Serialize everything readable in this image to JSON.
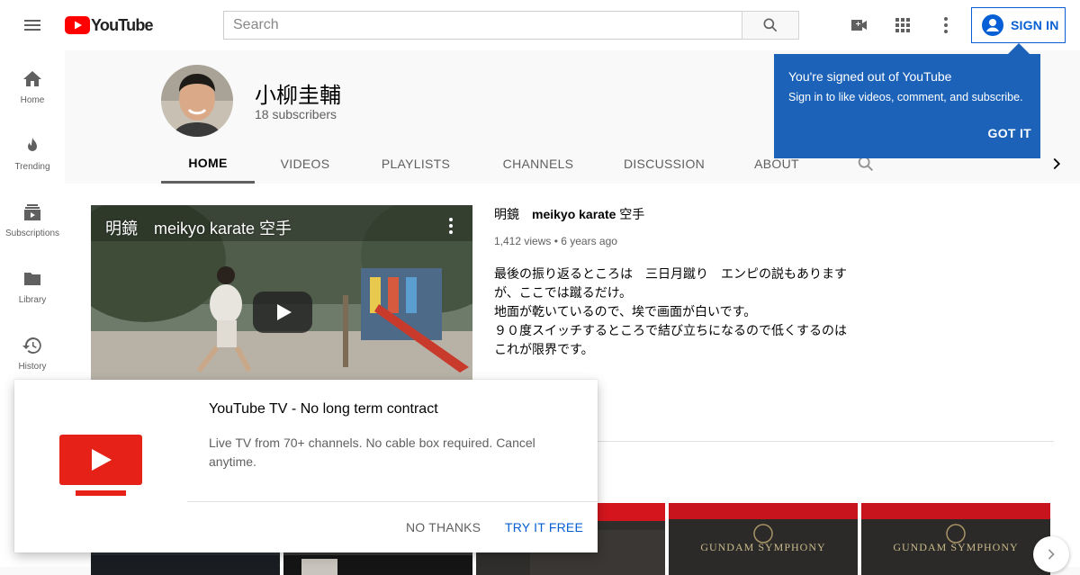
{
  "topbar": {
    "logo_text": "YouTube",
    "search_placeholder": "Search",
    "signin_label": "SIGN IN",
    "icons": [
      "menu-icon",
      "youtube-logo-icon",
      "search-icon",
      "create-video-icon",
      "apps-grid-icon",
      "more-vert-icon",
      "account-circle-icon"
    ]
  },
  "sidebar": {
    "items": [
      {
        "label": "Home",
        "icon": "home-icon"
      },
      {
        "label": "Trending",
        "icon": "fire-icon"
      },
      {
        "label": "Subscriptions",
        "icon": "subscriptions-icon"
      },
      {
        "label": "Library",
        "icon": "folder-icon"
      },
      {
        "label": "History",
        "icon": "history-icon"
      }
    ]
  },
  "channel": {
    "name": "小柳圭輔",
    "subscribers": "18 subscribers",
    "tabs": [
      "HOME",
      "VIDEOS",
      "PLAYLISTS",
      "CHANNELS",
      "DISCUSSION",
      "ABOUT"
    ],
    "active_tab": "HOME"
  },
  "featured_video": {
    "overlay_title": "明鏡　meikyo karate 空手",
    "title_prefix": "明鏡　",
    "title_bold": "meikyo karate",
    "title_suffix": " 空手",
    "views": "1,412 views",
    "age": "6 years ago",
    "description": [
      "最後の振り返るところは　三日月蹴り　エンピの説もあります",
      "が、ここでは蹴るだけ。",
      "地面が乾いているので、埃で画面が白いです。",
      "９０度スイッチするところで結び立ちになるので低くするのは",
      "これが限界です。"
    ]
  },
  "cards": {
    "labels": [
      "GUNDAM SYMPHONY",
      "GUNDAM SYMPHONY"
    ]
  },
  "signed_out_tooltip": {
    "title": "You're signed out of YouTube",
    "subtitle": "Sign in to like videos, comment, and subscribe.",
    "button": "GOT IT"
  },
  "promo": {
    "title": "YouTube TV - No long term contract",
    "description": "Live TV from 70+ channels. No cable box required. Cancel anytime.",
    "no_thanks": "NO THANKS",
    "try_free": "TRY IT FREE"
  },
  "colors": {
    "brand_red": "#ff0000",
    "link_blue": "#065fd4",
    "tooltip_blue": "#1c62b9"
  }
}
